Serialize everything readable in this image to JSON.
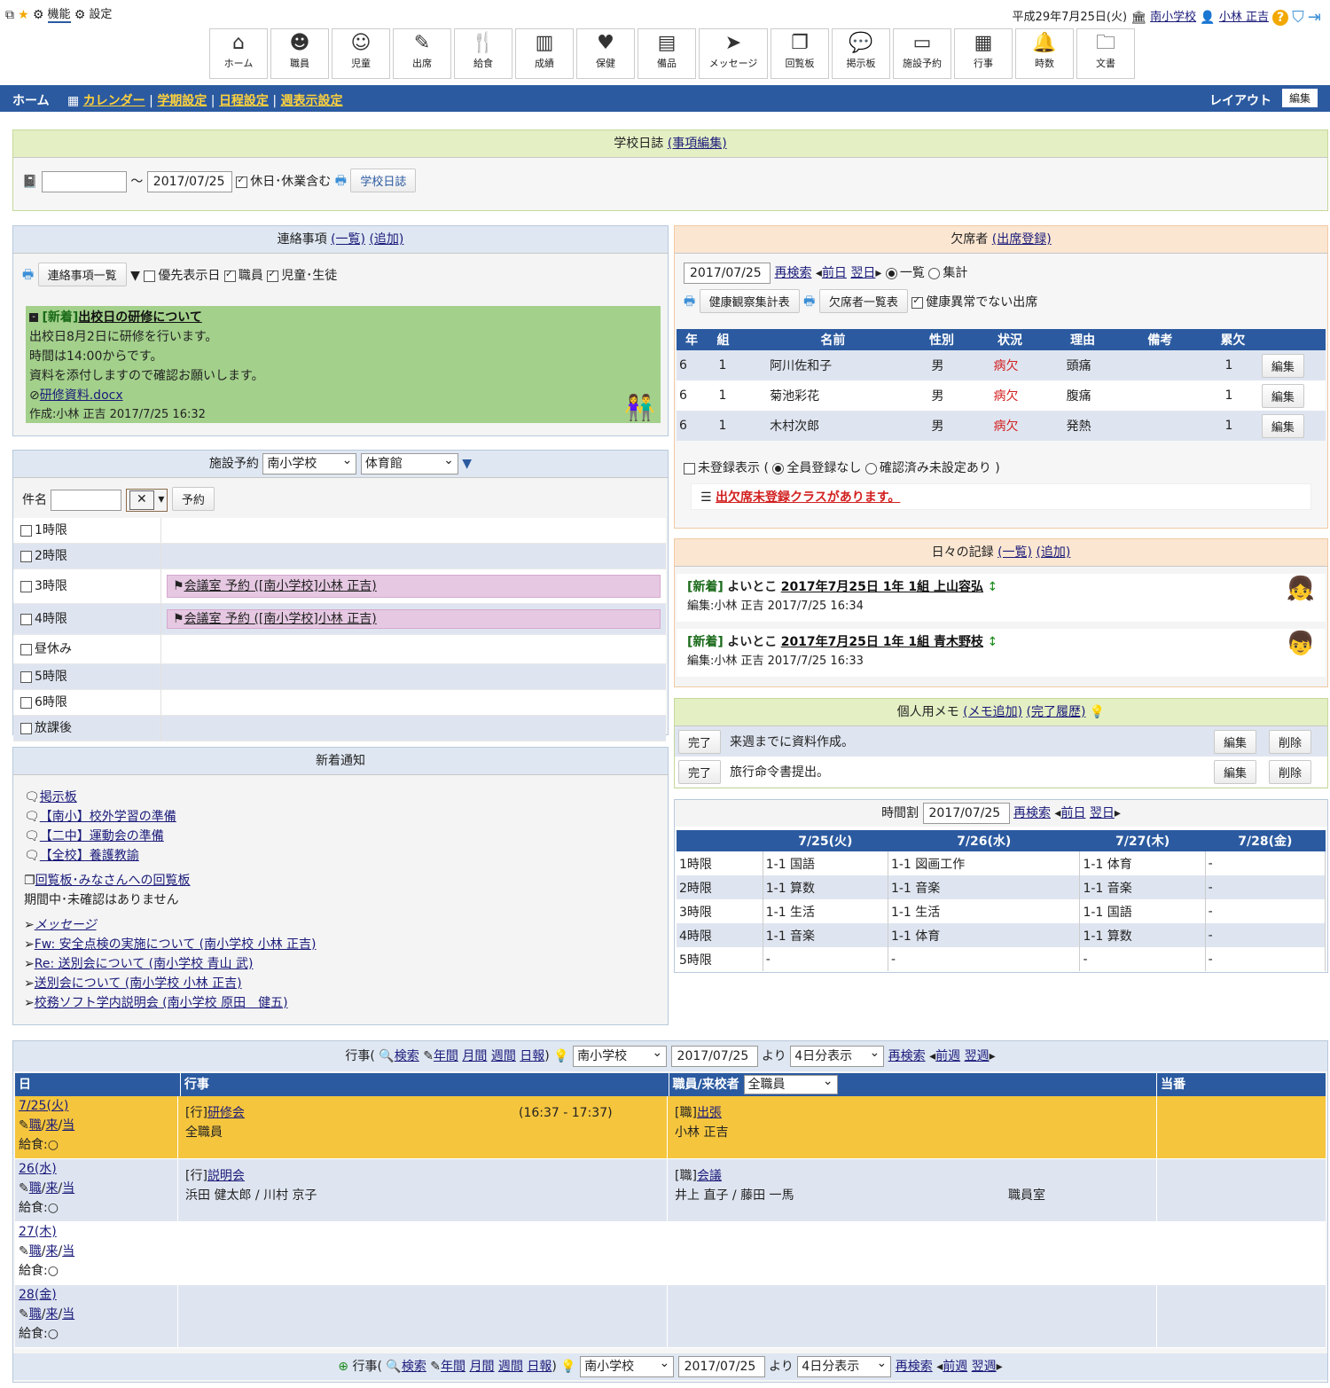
{
  "topbar": {
    "features": "機能",
    "settings": "設定",
    "date": "平成29年7月25日(火)",
    "school": "南小学校",
    "user": "小林 正吉"
  },
  "nav": [
    {
      "label": "ホーム",
      "icon": "home-icon",
      "glyph": "⌂"
    },
    {
      "label": "職員",
      "icon": "staff-icon",
      "glyph": "☻"
    },
    {
      "label": "児童",
      "icon": "child-icon",
      "glyph": "☺"
    },
    {
      "label": "出席",
      "icon": "attendance-icon",
      "glyph": "✎"
    },
    {
      "label": "給食",
      "icon": "lunch-icon",
      "glyph": "🍴"
    },
    {
      "label": "成績",
      "icon": "grades-icon",
      "glyph": "▥"
    },
    {
      "label": "保健",
      "icon": "health-icon",
      "glyph": "♥"
    },
    {
      "label": "備品",
      "icon": "supplies-icon",
      "glyph": "▤"
    },
    {
      "label": "メッセージ",
      "icon": "message-icon",
      "glyph": "➤"
    },
    {
      "label": "回覧板",
      "icon": "circular-icon",
      "glyph": "❐"
    },
    {
      "label": "掲示板",
      "icon": "board-icon",
      "glyph": "💬"
    },
    {
      "label": "施設予約",
      "icon": "facility-icon",
      "glyph": "▭"
    },
    {
      "label": "行事",
      "icon": "events-icon",
      "glyph": "▦"
    },
    {
      "label": "時数",
      "icon": "hours-icon",
      "glyph": "🔔"
    },
    {
      "label": "文書",
      "icon": "docs-icon",
      "glyph": "🗀"
    }
  ],
  "bluebar": {
    "home": "ホーム",
    "links": [
      "カレンダー",
      "学期設定",
      "日程設定",
      "週表示設定"
    ],
    "layout": "レイアウト",
    "edit": "編集"
  },
  "diary": {
    "title": "学校日誌",
    "edit_link": "(事項編集)",
    "date_to": "2017/07/25",
    "tilde": "〜",
    "include_holidays": "休日･休業含む",
    "button": "学校日誌"
  },
  "notices": {
    "title": "連絡事項",
    "list_link": "(一覧)",
    "add_link": "(追加)",
    "list_button": "連絡事項一覧",
    "filter_priority": "優先表示日",
    "filter_staff": "職員",
    "filter_students": "児童･生徒",
    "item": {
      "badge": "[新着]",
      "title": "出校日の研修について",
      "lines": [
        "出校日8月2日に研修を行います。",
        "時間は14:00からです。",
        "資料を添付しますので確認お願いします。"
      ],
      "attachment": "研修資料.docx",
      "author": "作成:小林 正吉 2017/7/25 16:32"
    }
  },
  "facility": {
    "title": "施設予約",
    "school": "南小学校",
    "room": "体育館",
    "name_label": "件名",
    "reserve_button": "予約",
    "periods": [
      {
        "label": "1時限",
        "entry": ""
      },
      {
        "label": "2時限",
        "entry": ""
      },
      {
        "label": "3時限",
        "entry": "会議室 予約 ([南小学校]小林 正吉)"
      },
      {
        "label": "4時限",
        "entry": "会議室 予約 ([南小学校]小林 正吉)"
      },
      {
        "label": "昼休み",
        "entry": ""
      },
      {
        "label": "5時限",
        "entry": ""
      },
      {
        "label": "6時限",
        "entry": ""
      },
      {
        "label": "放課後",
        "entry": ""
      }
    ]
  },
  "news": {
    "title": "新着通知",
    "board_title": "掲示板",
    "board_items": [
      "【南小】校外学習の準備",
      "【二中】運動会の準備",
      "【全校】養護教諭"
    ],
    "circular_title": "回覧板･みなさんへの回覧板",
    "circular_note": "期間中･未確認はありません",
    "message_title": "メッセージ",
    "message_items": [
      "Fw: 安全点検の実施について (南小学校 小林 正吉)",
      "Re: 送別会について (南小学校 青山 武)",
      "送別会について (南小学校 小林 正吉)",
      "校務ソフト学内説明会 (南小学校 原田　健五)"
    ]
  },
  "absent": {
    "title": "欠席者",
    "register_link": "(出席登録)",
    "date": "2017/07/25",
    "research": "再検索",
    "prev": "前日",
    "next": "翌日",
    "view_list": "一覧",
    "view_total": "集計",
    "btn_health": "健康観察集計表",
    "btn_absent": "欠席者一覧表",
    "chk_normal": "健康異常でない出席",
    "headers": [
      "年",
      "組",
      "名前",
      "性別",
      "状況",
      "理由",
      "備考",
      "累欠"
    ],
    "rows": [
      {
        "grade": "6",
        "cls": "1",
        "name": "阿川佐和子",
        "sex": "男",
        "status": "病欠",
        "reason": "頭痛",
        "note": "",
        "count": "1",
        "edit": "編集"
      },
      {
        "grade": "6",
        "cls": "1",
        "name": "菊池彩花",
        "sex": "男",
        "status": "病欠",
        "reason": "腹痛",
        "note": "",
        "count": "1",
        "edit": "編集"
      },
      {
        "grade": "6",
        "cls": "1",
        "name": "木村次郎",
        "sex": "男",
        "status": "病欠",
        "reason": "発熱",
        "note": "",
        "count": "1",
        "edit": "編集"
      }
    ],
    "unregistered": "未登録表示 (",
    "opt_all": "全員登録なし",
    "opt_confirmed": "確認済み未設定あり )",
    "warning": "出欠席未登録クラスがあります。"
  },
  "daily": {
    "title": "日々の記録",
    "list_link": "(一覧)",
    "add_link": "(追加)",
    "items": [
      {
        "badge": "[新着]",
        "prefix": "よいとこ",
        "title": "2017年7月25日 1年 1組 上山容弘",
        "editor": "編集:小林 正吉 2017/7/25 16:34"
      },
      {
        "badge": "[新着]",
        "prefix": "よいとこ",
        "title": "2017年7月25日 1年 1組 青木野枝",
        "editor": "編集:小林 正吉 2017/7/25 16:33"
      }
    ]
  },
  "memo": {
    "title": "個人用メモ",
    "add_link": "(メモ追加)",
    "history_link": "(完了履歴)",
    "items": [
      {
        "done": "完了",
        "text": "来週までに資料作成。",
        "edit": "編集",
        "delete": "削除"
      },
      {
        "done": "完了",
        "text": "旅行命令書提出。",
        "edit": "編集",
        "delete": "削除"
      }
    ]
  },
  "timetable": {
    "title": "時間割",
    "date": "2017/07/25",
    "research": "再検索",
    "prev": "前日",
    "next": "翌日",
    "days": [
      "7/25(火)",
      "7/26(水)",
      "7/27(木)",
      "7/28(金)"
    ],
    "rows": [
      {
        "period": "1時限",
        "cells": [
          "1-1 国語",
          "1-1 図画工作",
          "1-1 体育",
          "-"
        ]
      },
      {
        "period": "2時限",
        "cells": [
          "1-1 算数",
          "1-1 音楽",
          "1-1 音楽",
          "-"
        ]
      },
      {
        "period": "3時限",
        "cells": [
          "1-1 生活",
          "1-1 生活",
          "1-1 国語",
          "-"
        ]
      },
      {
        "period": "4時限",
        "cells": [
          "1-1 音楽",
          "1-1 体育",
          "1-1 算数",
          "-"
        ]
      },
      {
        "period": "5時限",
        "cells": [
          "-",
          "-",
          "-",
          "-"
        ]
      }
    ]
  },
  "events": {
    "title": "行事",
    "search": "検索",
    "year": "年間",
    "month": "月間",
    "week": "週間",
    "daily": "日報",
    "school": "南小学校",
    "date": "2017/07/25",
    "from": "より",
    "range": "4日分表示",
    "research": "再検索",
    "prev": "前週",
    "next": "翌週",
    "col_day": "日",
    "col_event": "行事",
    "col_staff": "職員/来校者",
    "staff_filter": "全職員",
    "col_duty": "当番",
    "links_text": [
      "職",
      "来",
      "当"
    ],
    "lunch": "給食:○",
    "rows": [
      {
        "day": "7/25(火)",
        "event_tag": "[行]",
        "event": "研修会",
        "event_sub": "全職員",
        "time": "(16:37 - 17:37)",
        "staff_tag": "[職]",
        "staff": "出張",
        "staff_sub": "小林 正吉",
        "place": ""
      },
      {
        "day": "26(水)",
        "event_tag": "[行]",
        "event": "説明会",
        "event_sub": "浜田 健太郎 / 川村 京子",
        "time": "",
        "staff_tag": "[職]",
        "staff": "会議",
        "staff_sub": "井上 直子 / 藤田 一馬",
        "place": "職員室"
      },
      {
        "day": "27(木)",
        "event_tag": "",
        "event": "",
        "event_sub": "",
        "time": "",
        "staff_tag": "",
        "staff": "",
        "staff_sub": "",
        "place": ""
      },
      {
        "day": "28(金)",
        "event_tag": "",
        "event": "",
        "event_sub": "",
        "time": "",
        "staff_tag": "",
        "staff": "",
        "staff_sub": "",
        "place": ""
      }
    ]
  },
  "colors": {
    "blue_bar": "#2b5aa0",
    "notice_green": "#a3d08b",
    "highlight_row": "#f5c53d",
    "reserve_pink": "#e6c8e2",
    "status_red": "#d22020"
  }
}
